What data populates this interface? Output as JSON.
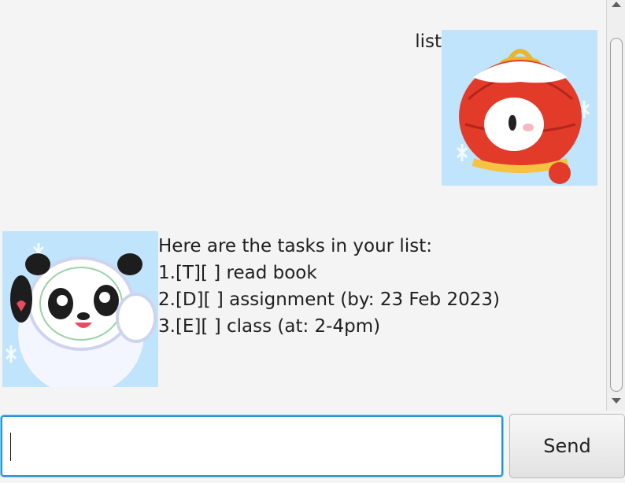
{
  "conversation": {
    "user_message": {
      "text": "list",
      "avatar_icon": "lantern-mascot-avatar"
    },
    "bot_message": {
      "avatar_icon": "panda-mascot-avatar",
      "lines": [
        "Here are the tasks in your list:",
        "1.[T][ ] read book",
        "2.[D][ ] assignment (by: 23 Feb 2023)",
        "3.[E][ ] class (at: 2-4pm)"
      ]
    }
  },
  "input": {
    "value": "",
    "placeholder": ""
  },
  "send_button": {
    "label": "Send"
  },
  "colors": {
    "background": "#f4f4f4",
    "input_focus_border": "#2596d1",
    "avatar_background": "#bfe4fb"
  }
}
